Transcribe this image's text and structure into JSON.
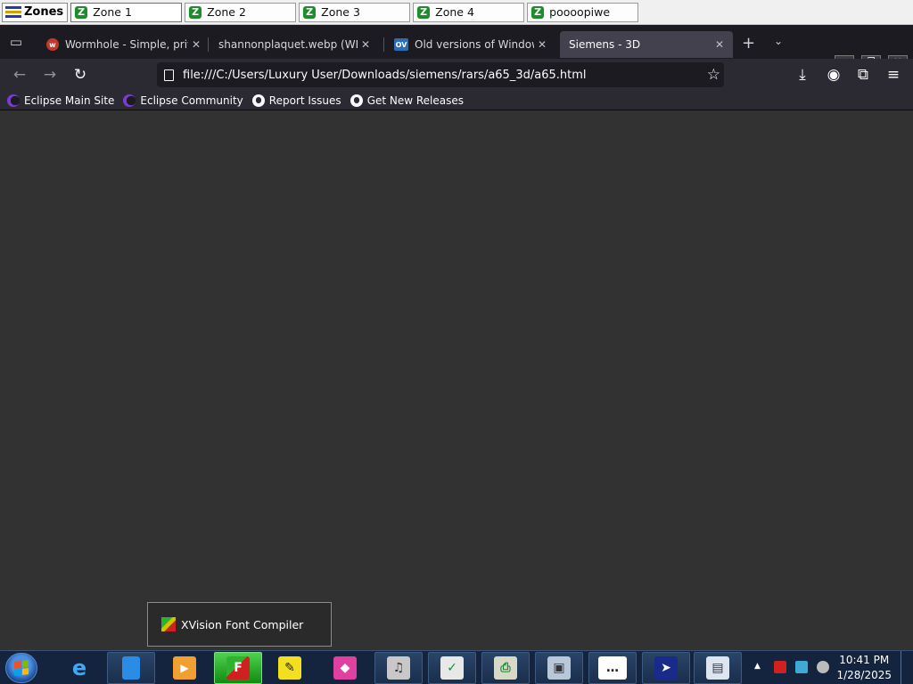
{
  "zones_bar": {
    "start_label": "Zones",
    "tabs": [
      {
        "label": "Zone 1"
      },
      {
        "label": "Zone 2"
      },
      {
        "label": "Zone 3"
      },
      {
        "label": "Zone 4"
      },
      {
        "label": "poooopiwe"
      }
    ]
  },
  "browser": {
    "tabs": [
      {
        "title": "Wormhole - Simple, privat",
        "favicon": "wormhole-icon"
      },
      {
        "title": "shannonplaquet.webp (WEBP",
        "favicon": "image-icon"
      },
      {
        "title": "Old versions of Windows,",
        "favicon_text": "OV"
      },
      {
        "title": "Siemens - 3D",
        "favicon": "none"
      }
    ],
    "url": "file:///C:/Users/Luxury User/Downloads/siemens/rars/a65_3d/a65.html",
    "bookmarks": [
      {
        "label": "Eclipse Main Site",
        "icon": "eclipse-icon"
      },
      {
        "label": "Eclipse Community",
        "icon": "eclipse-icon"
      },
      {
        "label": "Report Issues",
        "icon": "github-icon"
      },
      {
        "label": "Get New Releases",
        "icon": "github-icon"
      }
    ]
  },
  "popup": {
    "label": "XVision Font Compiler"
  },
  "taskbar": {
    "clock_time": "10:41 PM",
    "clock_date": "1/28/2025",
    "colors": {
      "taskbar_bg": "#14243e",
      "active_item": "#2db32d"
    }
  }
}
